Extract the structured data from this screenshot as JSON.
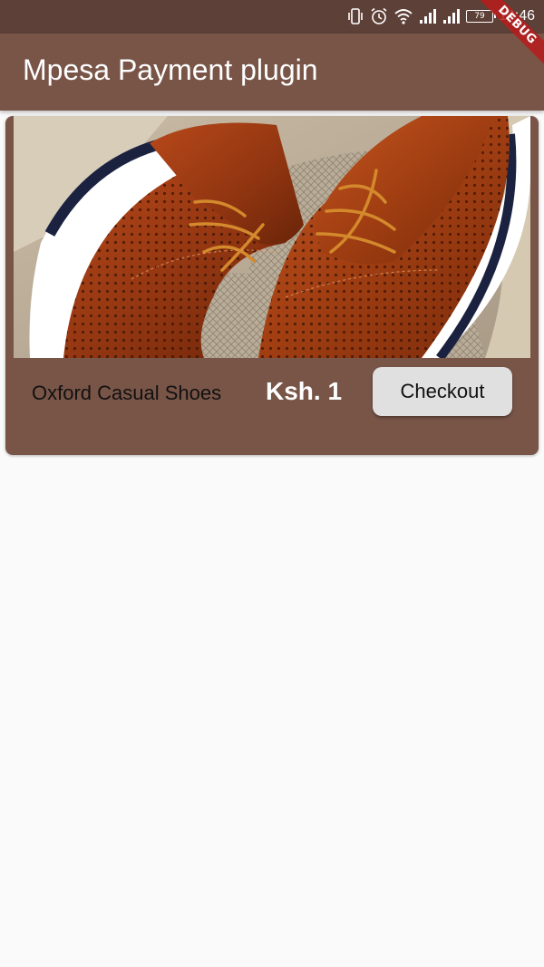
{
  "status_bar": {
    "battery_level": "79",
    "time": "13:46"
  },
  "app_bar": {
    "title": "Mpesa Payment plugin"
  },
  "debug_banner": {
    "label": "DEBUG"
  },
  "product": {
    "name": "Oxford Casual Shoes",
    "price": "Ksh. 1",
    "checkout_label": "Checkout"
  },
  "colors": {
    "status_bar": "#5d4037",
    "app_bar": "#795548",
    "card": "#795548",
    "button": "#e0e0e0",
    "background": "#fafafa"
  },
  "icons": [
    "vibrate-icon",
    "alarm-icon",
    "wifi-icon",
    "signal-icon",
    "signal-icon",
    "battery-icon"
  ]
}
